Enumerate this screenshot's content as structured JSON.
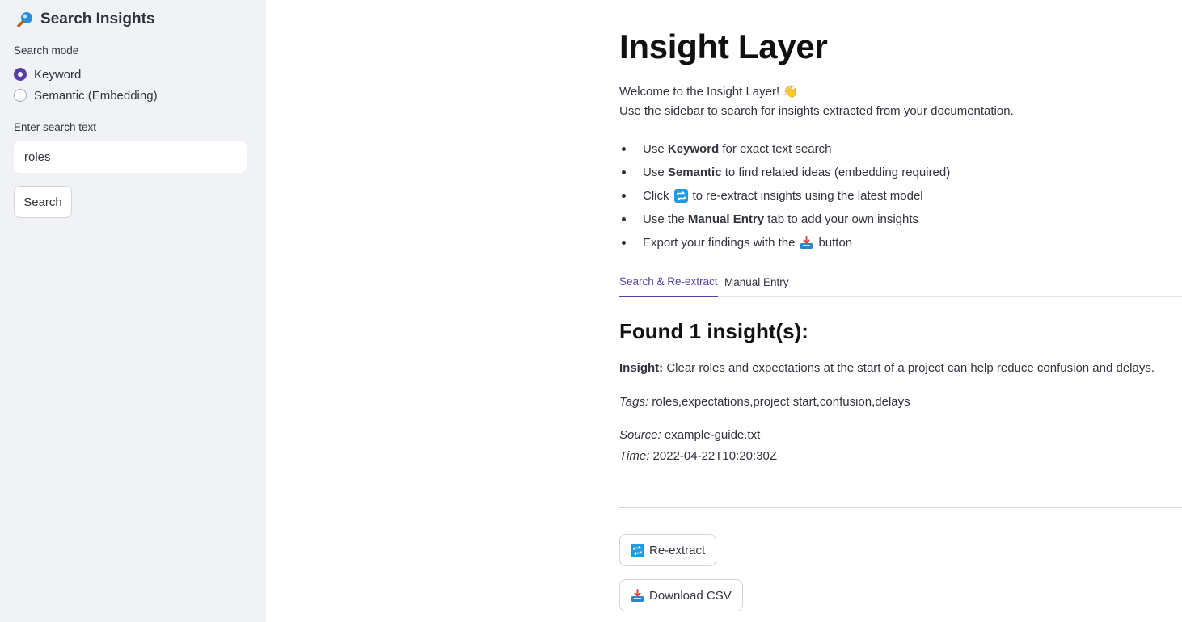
{
  "sidebar": {
    "title": "Search Insights",
    "title_icon": "magnifying-glass-icon",
    "search_mode_label": "Search mode",
    "modes": [
      {
        "label": "Keyword",
        "checked": true
      },
      {
        "label": "Semantic (Embedding)",
        "checked": false
      }
    ],
    "search_text_label": "Enter search text",
    "search_text_value": "roles",
    "search_button_label": "Search"
  },
  "main": {
    "title": "Insight Layer",
    "welcome": "Welcome to the Insight Layer! 👋",
    "intro": "Use the sidebar to search for insights extracted from your documentation.",
    "bullets": [
      {
        "pre": "Use ",
        "bold": "Keyword",
        "post": " for exact text search"
      },
      {
        "pre": "Use ",
        "bold": "Semantic",
        "post": " to find related ideas (embedding required)"
      },
      {
        "pre": "Click ",
        "icon": "repeat-icon",
        "post": " to re-extract insights using the latest model"
      },
      {
        "pre": "Use the ",
        "bold": "Manual Entry",
        "post": " tab to add your own insights"
      },
      {
        "pre": "Export your findings with the ",
        "icon": "inbox-tray-icon",
        "post": " button"
      }
    ],
    "tabs": [
      {
        "label": "Search & Re-extract",
        "active": true
      },
      {
        "label": "Manual Entry",
        "active": false
      }
    ],
    "found_title": "Found 1 insight(s):",
    "insight": {
      "label": "Insight:",
      "text": " Clear roles and expectations at the start of a project can help reduce confusion and delays.",
      "tags_label": "Tags:",
      "tags": " roles,expectations,project start,confusion,delays",
      "source_label": "Source:",
      "source": " example-guide.txt",
      "time_label": "Time:",
      "time": " 2022-04-22T10:20:30Z"
    },
    "reextract_button_label": "Re-extract",
    "download_button_label": "Download CSV"
  },
  "colors": {
    "accent": "#5a3ea6",
    "sidebar_bg": "#f0f2f6",
    "repeat_icon_bg": "#1f9ce0"
  }
}
